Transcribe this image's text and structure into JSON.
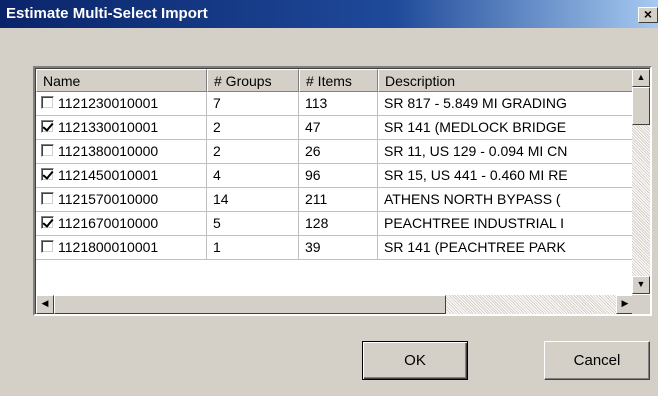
{
  "window": {
    "title": "Estimate Multi-Select Import",
    "close_label": "×"
  },
  "list": {
    "columns": [
      "Name",
      "# Groups",
      "# Items",
      "Description"
    ],
    "rows": [
      {
        "checked": false,
        "name": "1121230010001",
        "groups": "7",
        "items": "113",
        "description": "SR 817 - 5.849 MI GRADING"
      },
      {
        "checked": true,
        "name": "1121330010001",
        "groups": "2",
        "items": "47",
        "description": "SR 141 (MEDLOCK BRIDGE"
      },
      {
        "checked": false,
        "name": "1121380010000",
        "groups": "2",
        "items": "26",
        "description": "SR 11, US 129 - 0.094 MI CN"
      },
      {
        "checked": true,
        "name": "1121450010001",
        "groups": "4",
        "items": "96",
        "description": "SR 15, US 441 - 0.460 MI RE"
      },
      {
        "checked": false,
        "name": "1121570010000",
        "groups": "14",
        "items": "211",
        "description": "ATHENS NORTH BYPASS ("
      },
      {
        "checked": true,
        "name": "1121670010000",
        "groups": "5",
        "items": "128",
        "description": "PEACHTREE INDUSTRIAL I"
      },
      {
        "checked": false,
        "name": "1121800010001",
        "groups": "1",
        "items": "39",
        "description": "SR 141 (PEACHTREE PARK"
      }
    ]
  },
  "scroll": {
    "up_arrow": "▲",
    "down_arrow": "▼",
    "left_arrow": "◀",
    "right_arrow": "▶"
  },
  "buttons": {
    "ok_label": "OK",
    "cancel_label": "Cancel"
  }
}
